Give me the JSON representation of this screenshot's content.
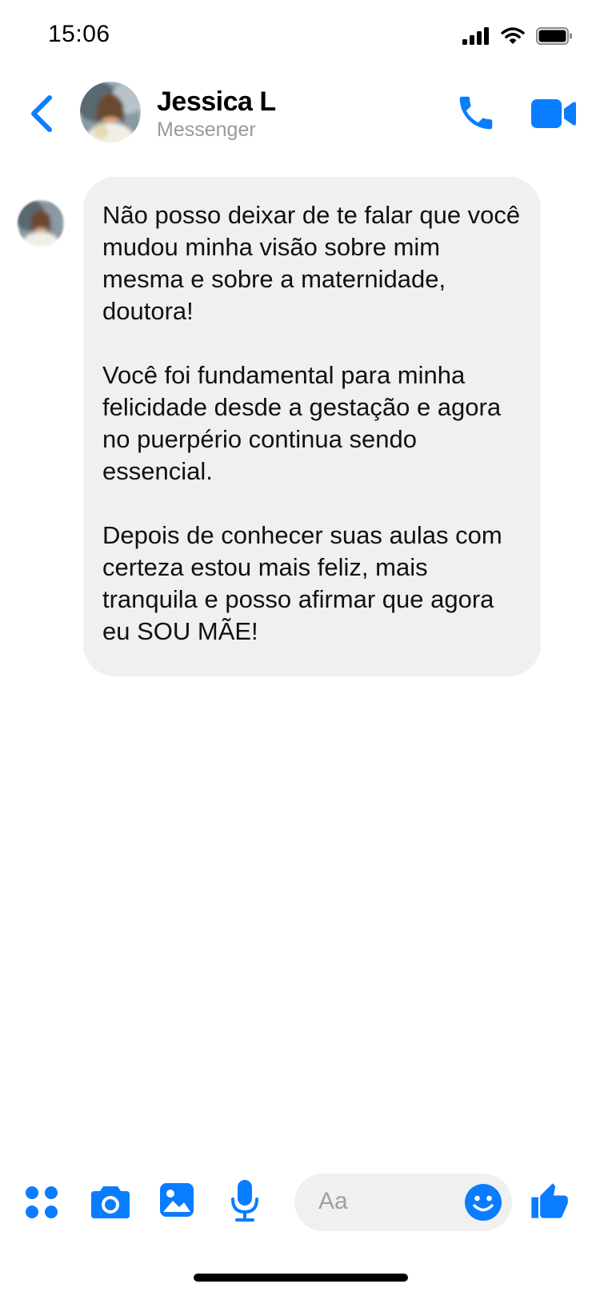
{
  "status": {
    "time": "15:06"
  },
  "header": {
    "name": "Jessica L",
    "subtitle": "Messenger"
  },
  "conversation": {
    "messages": [
      {
        "paragraphs": [
          "Não posso deixar de te falar que você mudou minha visão sobre mim mesma e sobre a maternidade, doutora!",
          "Você foi fundamental para minha felicidade desde a gestação e agora no puerpério continua sendo essencial.",
          "Depois de conhecer suas aulas com certeza estou mais feliz, mais tranquila e posso afirmar que agora eu SOU MÃE!"
        ]
      }
    ]
  },
  "composer": {
    "placeholder": "Aa",
    "icons": [
      "apps-icon",
      "camera-icon",
      "gallery-icon",
      "microphone-icon",
      "emoji-icon",
      "thumbs-up-icon"
    ]
  },
  "colors": {
    "accent": "#0A7CFF",
    "bubble": "#F0F0F0",
    "subtitle": "#9A9A9A"
  }
}
